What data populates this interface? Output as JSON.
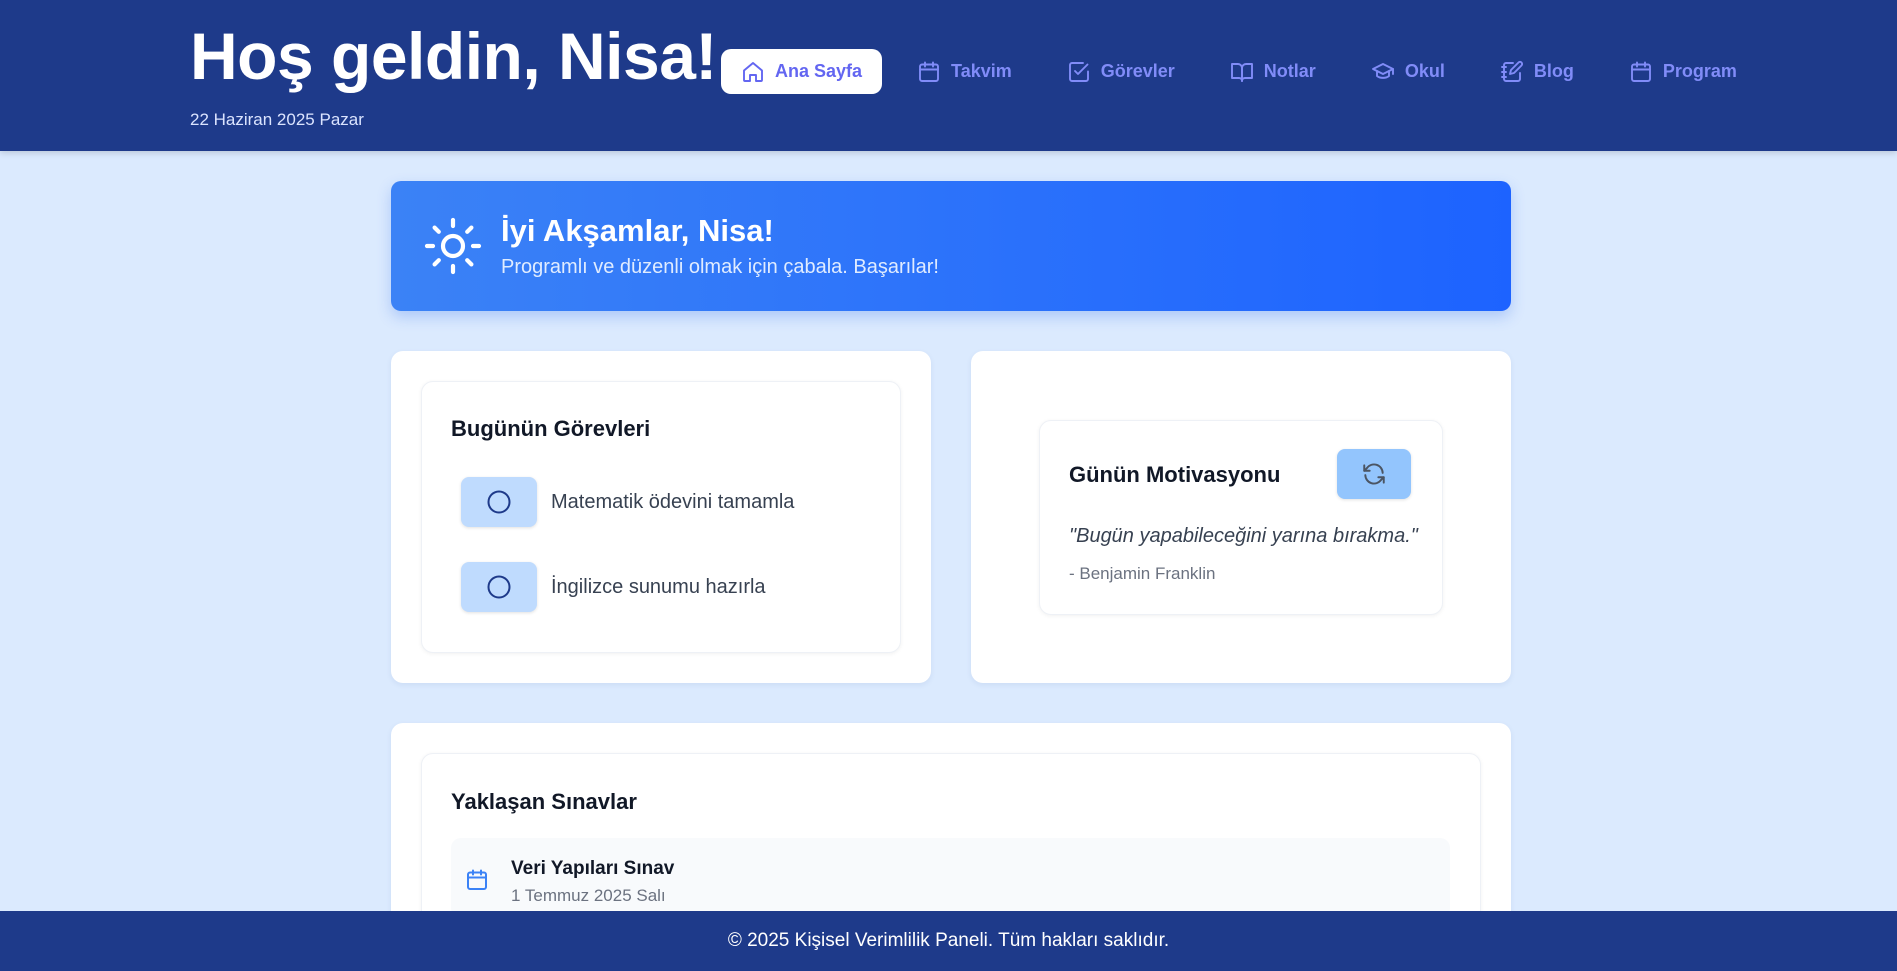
{
  "header": {
    "title": "Hoş geldin, Nisa!",
    "date": "22 Haziran 2025 Pazar"
  },
  "nav": {
    "items": [
      {
        "label": "Ana Sayfa",
        "icon": "home-icon",
        "active": true
      },
      {
        "label": "Takvim",
        "icon": "calendar-icon"
      },
      {
        "label": "Görevler",
        "icon": "check-square-icon"
      },
      {
        "label": "Notlar",
        "icon": "book-open-icon"
      },
      {
        "label": "Okul",
        "icon": "graduation-cap-icon"
      },
      {
        "label": "Blog",
        "icon": "notebook-pen-icon"
      },
      {
        "label": "Program",
        "icon": "calendar-icon"
      }
    ]
  },
  "hero": {
    "icon": "sun-icon",
    "title": "İyi Akşamlar, Nisa!",
    "subtitle": "Programlı ve düzenli olmak için çabala. Başarılar!"
  },
  "tasks": {
    "title": "Bugünün Görevleri",
    "items": [
      {
        "label": "Matematik ödevini tamamla",
        "done": false
      },
      {
        "label": "İngilizce sunumu hazırla",
        "done": false
      }
    ]
  },
  "motivation": {
    "title": "Günün Motivasyonu",
    "quote": "\"Bugün yapabileceğini yarına bırakma.\"",
    "author": "- Benjamin Franklin",
    "refresh_icon": "refresh-icon"
  },
  "exams": {
    "title": "Yaklaşan Sınavlar",
    "items": [
      {
        "name": "Veri Yapıları Sınav",
        "date": "1 Temmuz 2025 Salı"
      }
    ]
  },
  "footer": {
    "text": "© 2025 Kişisel Verimlilik Paneli. Tüm hakları saklıdır."
  },
  "colors": {
    "header_bg": "#1e3a8a",
    "page_bg": "#dbeafe",
    "accent": "#6366f1",
    "hero_gradient_start": "#3b82f6",
    "hero_gradient_end": "#1d63ff",
    "task_button": "#bfdbfe",
    "refresh_button": "#93c5fd"
  }
}
